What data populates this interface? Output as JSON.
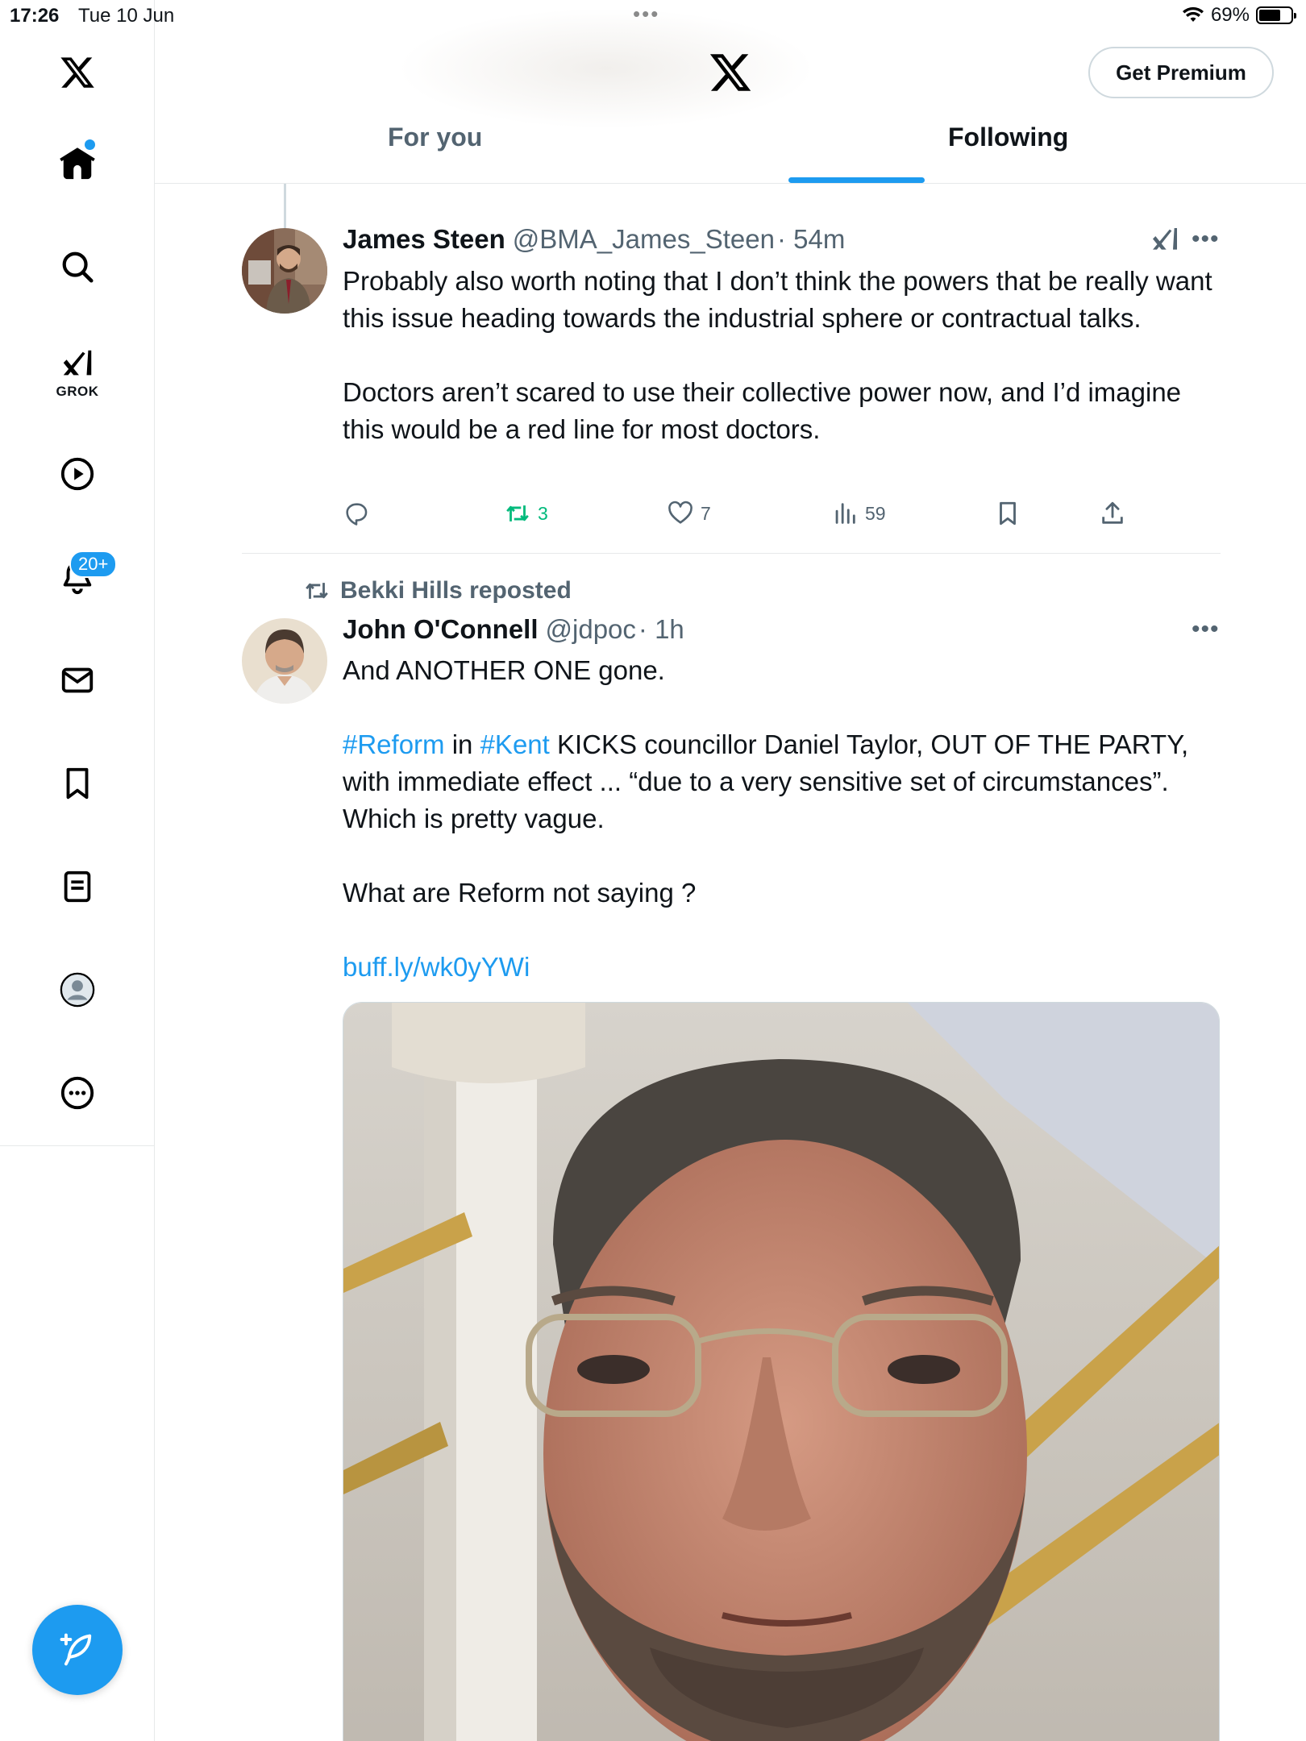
{
  "status_bar": {
    "time": "17:26",
    "date": "Tue 10 Jun",
    "battery": "69%",
    "battery_level": 0.69
  },
  "sidebar": {
    "items": [
      {
        "name": "home",
        "icon": "home-icon"
      },
      {
        "name": "search",
        "icon": "search-icon"
      },
      {
        "name": "grok",
        "icon": "grok-icon",
        "label": "GROK"
      },
      {
        "name": "video",
        "icon": "play-icon"
      },
      {
        "name": "notifications",
        "icon": "bell-icon",
        "badge": "20+"
      },
      {
        "name": "messages",
        "icon": "mail-icon"
      },
      {
        "name": "bookmarks",
        "icon": "bookmark-icon"
      },
      {
        "name": "lists",
        "icon": "list-icon"
      },
      {
        "name": "profile",
        "icon": "profile-icon"
      },
      {
        "name": "more",
        "icon": "more-icon"
      }
    ]
  },
  "header": {
    "premium_label": "Get Premium",
    "tabs": [
      {
        "label": "For you",
        "active": false
      },
      {
        "label": "Following",
        "active": true
      }
    ]
  },
  "tweets": [
    {
      "name": "James Steen",
      "handle": "@BMA_James_Steen",
      "time": "· 54m",
      "body": [
        "Probably also worth noting that I don’t think the powers that be really want this issue heading towards the industrial sphere or contractual talks.",
        "Doctors aren’t scared to use their collective power now, and I’d imagine this would be a red line for most doctors."
      ],
      "stats": {
        "replies": "",
        "retweets": "3",
        "likes": "7",
        "views": "59"
      }
    },
    {
      "reposted_by": "Bekki Hills reposted",
      "name": "John O'Connell",
      "handle": "@jdpoc",
      "time": "· 1h",
      "line1": "And ANOTHER ONE gone.",
      "hashtag1": "#Reform",
      "word_in": " in ",
      "hashtag2": "#Kent",
      "line2_rest": " KICKS councillor Daniel Taylor, OUT OF THE PARTY, with immediate effect ... “due to a very sensitive set of circumstances”. Which is pretty vague.",
      "line3": "What are Reform not saying ?",
      "link": "buff.ly/wk0yYWi"
    }
  ],
  "colors": {
    "accent": "#1d9bf0",
    "retweet": "#00ba7c",
    "text": "#0f1419",
    "secondary": "#536471",
    "border": "#e7e9ea"
  }
}
